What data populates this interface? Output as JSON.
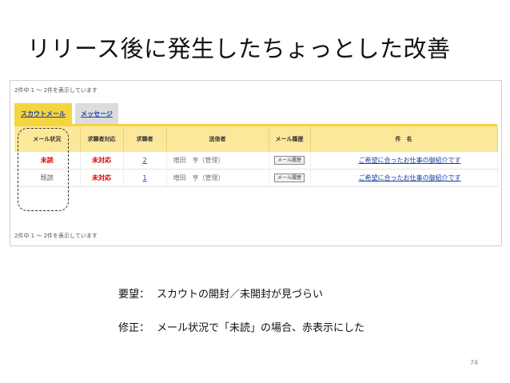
{
  "slide": {
    "title": "リリース後に発生したちょっとした改善",
    "page_number": "74"
  },
  "screenshot": {
    "top_count": "2件中 1 〜 2件を表示しています",
    "bottom_count": "2件中 1 〜 2件を表示しています",
    "tabs": [
      {
        "label": "スカウトメール",
        "active": true
      },
      {
        "label": "メッセージ",
        "active": false
      }
    ],
    "columns": [
      "メール状況",
      "求職者対応",
      "求職者",
      "送信者",
      "メール履歴",
      "件　名"
    ],
    "rows": [
      {
        "status": "未読",
        "response": "未対応",
        "seeker": "2",
        "sender": "増田　亨（管理）",
        "history_btn": "メール履歴",
        "subject": "ご希望に合ったお仕事の御紹介です"
      },
      {
        "status": "既読",
        "response": "未対応",
        "seeker": "1",
        "sender": "増田　亨（管理）",
        "history_btn": "メール履歴",
        "subject": "ご希望に合ったお仕事の御紹介です"
      }
    ]
  },
  "notes": {
    "request_label": "要望：",
    "request_text": "スカウトの開封／未開封が見づらい",
    "fix_label": "修正：",
    "fix_text": "メール状況で「未読」の場合、赤表示にした"
  }
}
